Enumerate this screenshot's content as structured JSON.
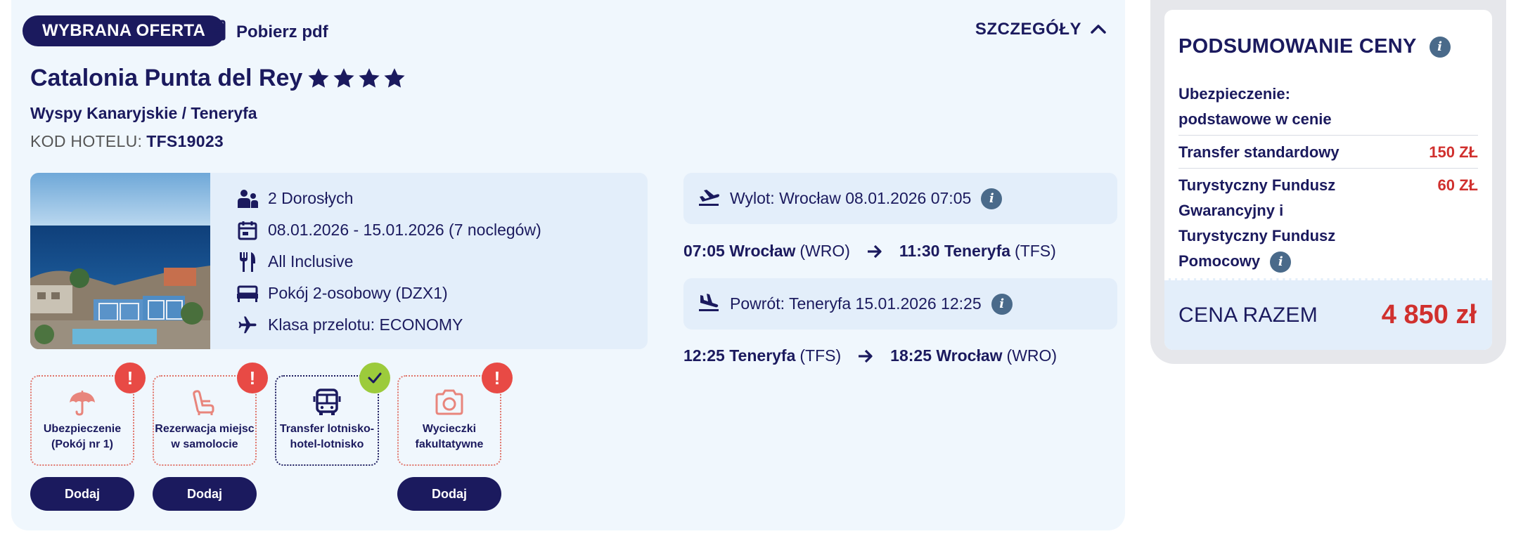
{
  "header": {
    "badge": "WYBRANA OFERTA",
    "pdf_label": "Pobierz pdf",
    "details_label": "SZCZEGÓŁY"
  },
  "hotel": {
    "name": "Catalonia Punta del Rey",
    "stars": 4,
    "location": "Wyspy Kanaryjskie / Teneryfa",
    "code_label": "KOD HOTELU:",
    "code_value": "TFS19023"
  },
  "trip_info": {
    "travelers": "2 Dorosłych",
    "dates": "08.01.2026 - 15.01.2026 (7 noclegów)",
    "board": "All Inclusive",
    "room": "Pokój 2-osobowy (DZX1)",
    "flight_class": "Klasa przelotu: ECONOMY"
  },
  "flights": {
    "outbound": {
      "header": "Wylot: Wrocław 08.01.2026 07:05",
      "dep_time_city": "07:05 Wrocław",
      "dep_code": "(WRO)",
      "arr_time_city": "11:30 Teneryfa",
      "arr_code": "(TFS)"
    },
    "return": {
      "header": "Powrót: Teneryfa 15.01.2026 12:25",
      "dep_time_city": "12:25 Teneryfa",
      "dep_code": "(TFS)",
      "arr_time_city": "18:25 Wrocław",
      "arr_code": "(WRO)"
    }
  },
  "addons": [
    {
      "label": "Ubezpieczenie (Pokój nr 1)",
      "icon": "umbrella-icon",
      "status": "warning",
      "button": "Dodaj"
    },
    {
      "label": "Rezerwacja miejsc w samolocie",
      "icon": "seat-icon",
      "status": "warning",
      "button": "Dodaj"
    },
    {
      "label": "Transfer lotnisko-hotel-lotnisko",
      "icon": "bus-icon",
      "status": "included",
      "button": ""
    },
    {
      "label": "Wycieczki fakultatywne",
      "icon": "camera-icon",
      "status": "warning",
      "button": "Dodaj"
    }
  ],
  "summary": {
    "title": "PODSUMOWANIE CENY",
    "rows": [
      {
        "label": "Ubezpieczenie: podstawowe w cenie",
        "price": ""
      },
      {
        "label": "Transfer standardowy",
        "price": "150 ZŁ"
      },
      {
        "label": "Turystyczny Fundusz Gwarancyjny i Turystyczny Fundusz Pomocowy",
        "price": "60 ZŁ"
      }
    ],
    "total_label": "CENA RAZEM",
    "total_value": "4 850 zł"
  },
  "colors": {
    "navy": "#1b1a5e",
    "card_bg": "#f0f7fd",
    "box_bg": "#e3eefa",
    "price_red": "#d0302e",
    "warning_red": "#e84a45",
    "ok_green": "#9ccb3b"
  }
}
